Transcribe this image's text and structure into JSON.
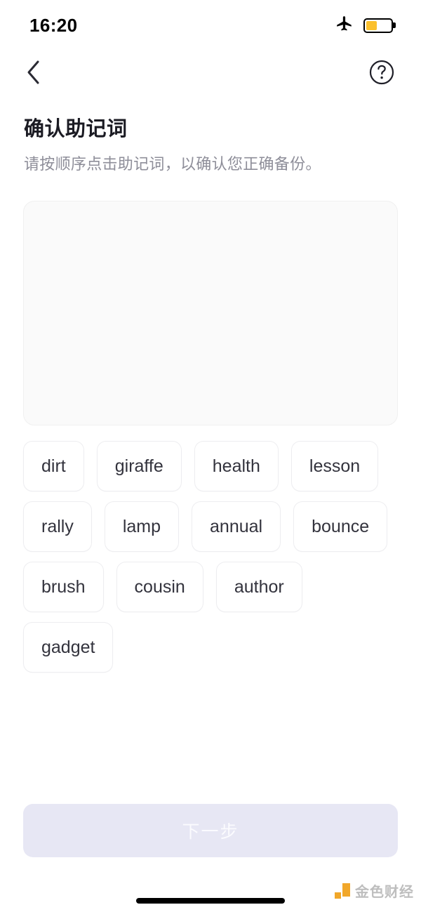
{
  "status_bar": {
    "time": "16:20",
    "airplane_icon": "airplane-mode-icon",
    "battery_icon": "battery-icon",
    "battery_level_percent": 45,
    "battery_color": "#fbc02d"
  },
  "nav": {
    "back_icon": "chevron-left-icon",
    "help_icon": "help-circle-icon"
  },
  "header": {
    "title": "确认助记词",
    "subtitle": "请按顺序点击助记词，以确认您正确备份。"
  },
  "dropzone": {
    "selected_words": [],
    "background_color": "#fafafa"
  },
  "word_pool": {
    "words": [
      "dirt",
      "giraffe",
      "health",
      "lesson",
      "rally",
      "lamp",
      "annual",
      "bounce",
      "brush",
      "cousin",
      "author",
      "gadget"
    ]
  },
  "footer": {
    "next_label": "下一步",
    "next_enabled": false,
    "next_bg_color": "#e7e7f4"
  },
  "watermark": {
    "text": "金色财经",
    "mark_color": "#f0a019"
  },
  "home_indicator": {
    "name": "home-indicator"
  }
}
